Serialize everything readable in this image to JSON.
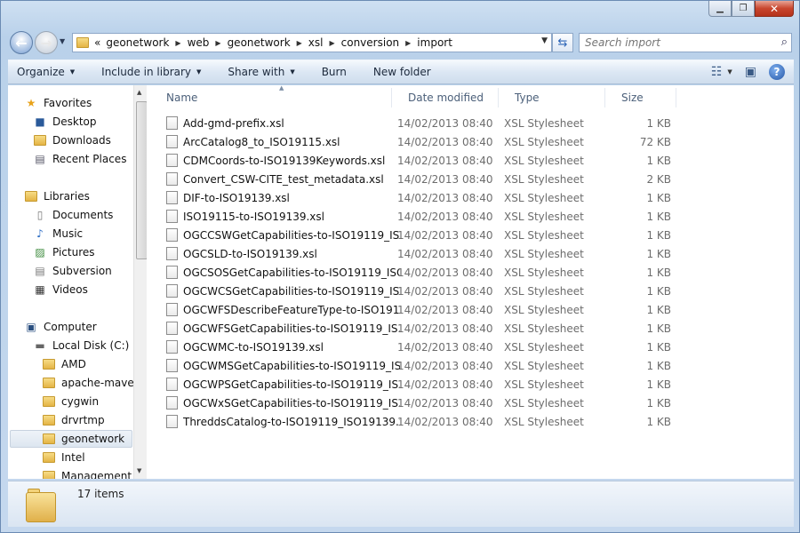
{
  "window": {
    "minimize": "▁",
    "maximize": "❐",
    "close": "✕"
  },
  "address": {
    "root_chevron": "«",
    "crumbs": [
      "geonetwork",
      "web",
      "geonetwork",
      "xsl",
      "conversion",
      "import"
    ]
  },
  "search": {
    "placeholder": "Search import"
  },
  "toolbar": {
    "organize": "Organize",
    "include_in_library": "Include in library",
    "share_with": "Share with",
    "burn": "Burn",
    "new_folder": "New folder"
  },
  "nav": {
    "favorites": "Favorites",
    "desktop": "Desktop",
    "downloads": "Downloads",
    "recent_places": "Recent Places",
    "libraries": "Libraries",
    "documents": "Documents",
    "music": "Music",
    "pictures": "Pictures",
    "subversion": "Subversion",
    "videos": "Videos",
    "computer": "Computer",
    "local_disk": "Local Disk (C:)",
    "amd": "AMD",
    "apache_maven": "apache-maven",
    "cygwin": "cygwin",
    "drvrtmp": "drvrtmp",
    "geonetwork": "geonetwork",
    "intel": "Intel",
    "management": "Management"
  },
  "columns": {
    "name": "Name",
    "date": "Date modified",
    "type": "Type",
    "size": "Size"
  },
  "files": [
    {
      "name": "Add-gmd-prefix.xsl",
      "date": "14/02/2013 08:40",
      "type": "XSL Stylesheet",
      "size": "1 KB"
    },
    {
      "name": "ArcCatalog8_to_ISO19115.xsl",
      "date": "14/02/2013 08:40",
      "type": "XSL Stylesheet",
      "size": "72 KB"
    },
    {
      "name": "CDMCoords-to-ISO19139Keywords.xsl",
      "date": "14/02/2013 08:40",
      "type": "XSL Stylesheet",
      "size": "1 KB"
    },
    {
      "name": "Convert_CSW-CITE_test_metadata.xsl",
      "date": "14/02/2013 08:40",
      "type": "XSL Stylesheet",
      "size": "2 KB"
    },
    {
      "name": "DIF-to-ISO19139.xsl",
      "date": "14/02/2013 08:40",
      "type": "XSL Stylesheet",
      "size": "1 KB"
    },
    {
      "name": "ISO19115-to-ISO19139.xsl",
      "date": "14/02/2013 08:40",
      "type": "XSL Stylesheet",
      "size": "1 KB"
    },
    {
      "name": "OGCCSWGetCapabilities-to-ISO19119_IS...",
      "date": "14/02/2013 08:40",
      "type": "XSL Stylesheet",
      "size": "1 KB"
    },
    {
      "name": "OGCSLD-to-ISO19139.xsl",
      "date": "14/02/2013 08:40",
      "type": "XSL Stylesheet",
      "size": "1 KB"
    },
    {
      "name": "OGCSOSGetCapabilities-to-ISO19119_ISO...",
      "date": "14/02/2013 08:40",
      "type": "XSL Stylesheet",
      "size": "1 KB"
    },
    {
      "name": "OGCWCSGetCapabilities-to-ISO19119_IS...",
      "date": "14/02/2013 08:40",
      "type": "XSL Stylesheet",
      "size": "1 KB"
    },
    {
      "name": "OGCWFSDescribeFeatureType-to-ISO191...",
      "date": "14/02/2013 08:40",
      "type": "XSL Stylesheet",
      "size": "1 KB"
    },
    {
      "name": "OGCWFSGetCapabilities-to-ISO19119_IS...",
      "date": "14/02/2013 08:40",
      "type": "XSL Stylesheet",
      "size": "1 KB"
    },
    {
      "name": "OGCWMC-to-ISO19139.xsl",
      "date": "14/02/2013 08:40",
      "type": "XSL Stylesheet",
      "size": "1 KB"
    },
    {
      "name": "OGCWMSGetCapabilities-to-ISO19119_IS...",
      "date": "14/02/2013 08:40",
      "type": "XSL Stylesheet",
      "size": "1 KB"
    },
    {
      "name": "OGCWPSGetCapabilities-to-ISO19119_IS...",
      "date": "14/02/2013 08:40",
      "type": "XSL Stylesheet",
      "size": "1 KB"
    },
    {
      "name": "OGCWxSGetCapabilities-to-ISO19119_IS...",
      "date": "14/02/2013 08:40",
      "type": "XSL Stylesheet",
      "size": "1 KB"
    },
    {
      "name": "ThreddsCatalog-to-ISO19119_ISO19139.xsl",
      "date": "14/02/2013 08:40",
      "type": "XSL Stylesheet",
      "size": "1 KB"
    }
  ],
  "status": {
    "count": "17 items"
  }
}
